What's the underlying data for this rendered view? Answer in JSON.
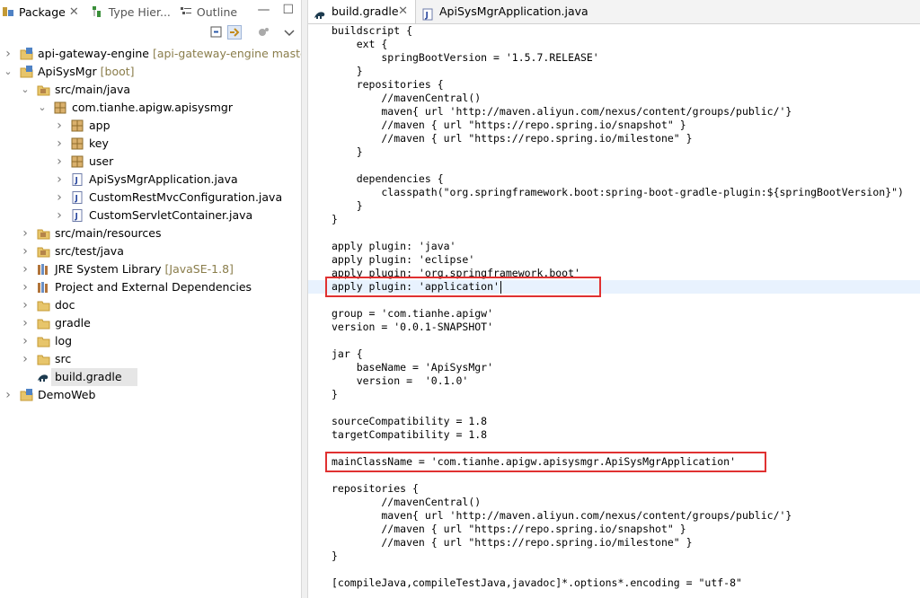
{
  "left_tabs": [
    {
      "label": "Package",
      "close": "✕"
    },
    {
      "label": "Type Hier..."
    },
    {
      "label": "Outline"
    }
  ],
  "icons": {
    "minimize": "—",
    "maximize": "☐",
    "collapse_all": "collapse-all-icon",
    "link_editor": "link-with-editor-icon",
    "view_menu": "view-menu-icon"
  },
  "tree": [
    {
      "label": "api-gateway-engine",
      "deco": "[api-gateway-engine master]",
      "depth": 0,
      "arrow": "›",
      "icon": "project"
    },
    {
      "label": "ApiSysMgr",
      "deco": "[boot]",
      "depth": 0,
      "arrow": "⌄",
      "icon": "project"
    },
    {
      "label": "src/main/java",
      "deco": "",
      "depth": 1,
      "arrow": "⌄",
      "icon": "srcfolder"
    },
    {
      "label": "com.tianhe.apigw.apisysmgr",
      "deco": "",
      "depth": 2,
      "arrow": "⌄",
      "icon": "package"
    },
    {
      "label": "app",
      "deco": "",
      "depth": 3,
      "arrow": "›",
      "icon": "package"
    },
    {
      "label": "key",
      "deco": "",
      "depth": 3,
      "arrow": "›",
      "icon": "package"
    },
    {
      "label": "user",
      "deco": "",
      "depth": 3,
      "arrow": "›",
      "icon": "package"
    },
    {
      "label": "ApiSysMgrApplication.java",
      "deco": "",
      "depth": 3,
      "arrow": "›",
      "icon": "java"
    },
    {
      "label": "CustomRestMvcConfiguration.java",
      "deco": "",
      "depth": 3,
      "arrow": "›",
      "icon": "java"
    },
    {
      "label": "CustomServletContainer.java",
      "deco": "",
      "depth": 3,
      "arrow": "›",
      "icon": "java"
    },
    {
      "label": "src/main/resources",
      "deco": "",
      "depth": 1,
      "arrow": "›",
      "icon": "srcfolder"
    },
    {
      "label": "src/test/java",
      "deco": "",
      "depth": 1,
      "arrow": "›",
      "icon": "srcfolder"
    },
    {
      "label": "JRE System Library",
      "deco": "[JavaSE-1.8]",
      "depth": 1,
      "arrow": "›",
      "icon": "library"
    },
    {
      "label": "Project and External Dependencies",
      "deco": "",
      "depth": 1,
      "arrow": "›",
      "icon": "library"
    },
    {
      "label": "doc",
      "deco": "",
      "depth": 1,
      "arrow": "›",
      "icon": "folder"
    },
    {
      "label": "gradle",
      "deco": "",
      "depth": 1,
      "arrow": "›",
      "icon": "folder"
    },
    {
      "label": "log",
      "deco": "",
      "depth": 1,
      "arrow": "›",
      "icon": "folder"
    },
    {
      "label": "src",
      "deco": "",
      "depth": 1,
      "arrow": "›",
      "icon": "folder"
    },
    {
      "label": "build.gradle",
      "deco": "",
      "depth": 1,
      "arrow": "",
      "icon": "gradle",
      "selected": true
    },
    {
      "label": "DemoWeb",
      "deco": "",
      "depth": 0,
      "arrow": "›",
      "icon": "project"
    }
  ],
  "editor_tabs": [
    {
      "label": "build.gradle",
      "close": "✕",
      "active": true
    },
    {
      "label": "ApiSysMgrApplication.java",
      "active": false
    }
  ],
  "code": [
    "buildscript {",
    "    ext {",
    "        springBootVersion = '1.5.7.RELEASE'",
    "    }",
    "    repositories {",
    "        //mavenCentral()",
    "        maven{ url 'http://maven.aliyun.com/nexus/content/groups/public/'}",
    "        //maven { url \"https://repo.spring.io/snapshot\" }",
    "        //maven { url \"https://repo.spring.io/milestone\" }",
    "    }",
    "",
    "    dependencies {",
    "        classpath(\"org.springframework.boot:spring-boot-gradle-plugin:${springBootVersion}\")",
    "    }",
    "}",
    "",
    "apply plugin: 'java'",
    "apply plugin: 'eclipse'",
    "apply plugin: 'org.springframework.boot'",
    "apply plugin: 'application'",
    "",
    "group = 'com.tianhe.apigw'",
    "version = '0.0.1-SNAPSHOT'",
    "",
    "jar {",
    "    baseName = 'ApiSysMgr'",
    "    version =  '0.1.0'",
    "}",
    "",
    "sourceCompatibility = 1.8",
    "targetCompatibility = 1.8",
    "",
    "mainClassName = 'com.tianhe.apigw.apisysmgr.ApiSysMgrApplication'",
    "",
    "repositories {",
    "        //mavenCentral()",
    "        maven{ url 'http://maven.aliyun.com/nexus/content/groups/public/'}",
    "        //maven { url \"https://repo.spring.io/snapshot\" }",
    "        //maven { url \"https://repo.spring.io/milestone\" }",
    "}",
    "",
    "[compileJava,compileTestJava,javadoc]*.options*.encoding = \"utf-8\""
  ],
  "current_line": 19,
  "highlight_colors": {
    "box": "#e03131",
    "current_line": "#e8f2fe"
  }
}
